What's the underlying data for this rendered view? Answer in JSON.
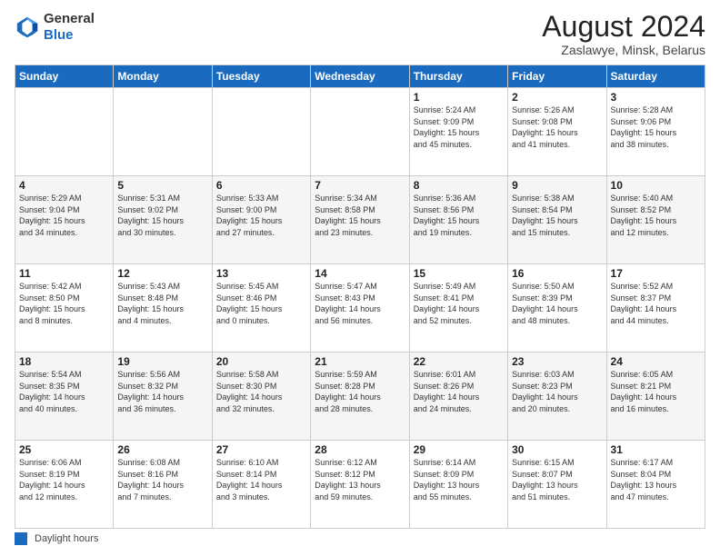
{
  "header": {
    "logo_line1": "General",
    "logo_line2": "Blue",
    "main_title": "August 2024",
    "subtitle": "Zaslawye, Minsk, Belarus"
  },
  "days_of_week": [
    "Sunday",
    "Monday",
    "Tuesday",
    "Wednesday",
    "Thursday",
    "Friday",
    "Saturday"
  ],
  "weeks": [
    [
      {
        "day": "",
        "info": ""
      },
      {
        "day": "",
        "info": ""
      },
      {
        "day": "",
        "info": ""
      },
      {
        "day": "",
        "info": ""
      },
      {
        "day": "1",
        "info": "Sunrise: 5:24 AM\nSunset: 9:09 PM\nDaylight: 15 hours\nand 45 minutes."
      },
      {
        "day": "2",
        "info": "Sunrise: 5:26 AM\nSunset: 9:08 PM\nDaylight: 15 hours\nand 41 minutes."
      },
      {
        "day": "3",
        "info": "Sunrise: 5:28 AM\nSunset: 9:06 PM\nDaylight: 15 hours\nand 38 minutes."
      }
    ],
    [
      {
        "day": "4",
        "info": "Sunrise: 5:29 AM\nSunset: 9:04 PM\nDaylight: 15 hours\nand 34 minutes."
      },
      {
        "day": "5",
        "info": "Sunrise: 5:31 AM\nSunset: 9:02 PM\nDaylight: 15 hours\nand 30 minutes."
      },
      {
        "day": "6",
        "info": "Sunrise: 5:33 AM\nSunset: 9:00 PM\nDaylight: 15 hours\nand 27 minutes."
      },
      {
        "day": "7",
        "info": "Sunrise: 5:34 AM\nSunset: 8:58 PM\nDaylight: 15 hours\nand 23 minutes."
      },
      {
        "day": "8",
        "info": "Sunrise: 5:36 AM\nSunset: 8:56 PM\nDaylight: 15 hours\nand 19 minutes."
      },
      {
        "day": "9",
        "info": "Sunrise: 5:38 AM\nSunset: 8:54 PM\nDaylight: 15 hours\nand 15 minutes."
      },
      {
        "day": "10",
        "info": "Sunrise: 5:40 AM\nSunset: 8:52 PM\nDaylight: 15 hours\nand 12 minutes."
      }
    ],
    [
      {
        "day": "11",
        "info": "Sunrise: 5:42 AM\nSunset: 8:50 PM\nDaylight: 15 hours\nand 8 minutes."
      },
      {
        "day": "12",
        "info": "Sunrise: 5:43 AM\nSunset: 8:48 PM\nDaylight: 15 hours\nand 4 minutes."
      },
      {
        "day": "13",
        "info": "Sunrise: 5:45 AM\nSunset: 8:46 PM\nDaylight: 15 hours\nand 0 minutes."
      },
      {
        "day": "14",
        "info": "Sunrise: 5:47 AM\nSunset: 8:43 PM\nDaylight: 14 hours\nand 56 minutes."
      },
      {
        "day": "15",
        "info": "Sunrise: 5:49 AM\nSunset: 8:41 PM\nDaylight: 14 hours\nand 52 minutes."
      },
      {
        "day": "16",
        "info": "Sunrise: 5:50 AM\nSunset: 8:39 PM\nDaylight: 14 hours\nand 48 minutes."
      },
      {
        "day": "17",
        "info": "Sunrise: 5:52 AM\nSunset: 8:37 PM\nDaylight: 14 hours\nand 44 minutes."
      }
    ],
    [
      {
        "day": "18",
        "info": "Sunrise: 5:54 AM\nSunset: 8:35 PM\nDaylight: 14 hours\nand 40 minutes."
      },
      {
        "day": "19",
        "info": "Sunrise: 5:56 AM\nSunset: 8:32 PM\nDaylight: 14 hours\nand 36 minutes."
      },
      {
        "day": "20",
        "info": "Sunrise: 5:58 AM\nSunset: 8:30 PM\nDaylight: 14 hours\nand 32 minutes."
      },
      {
        "day": "21",
        "info": "Sunrise: 5:59 AM\nSunset: 8:28 PM\nDaylight: 14 hours\nand 28 minutes."
      },
      {
        "day": "22",
        "info": "Sunrise: 6:01 AM\nSunset: 8:26 PM\nDaylight: 14 hours\nand 24 minutes."
      },
      {
        "day": "23",
        "info": "Sunrise: 6:03 AM\nSunset: 8:23 PM\nDaylight: 14 hours\nand 20 minutes."
      },
      {
        "day": "24",
        "info": "Sunrise: 6:05 AM\nSunset: 8:21 PM\nDaylight: 14 hours\nand 16 minutes."
      }
    ],
    [
      {
        "day": "25",
        "info": "Sunrise: 6:06 AM\nSunset: 8:19 PM\nDaylight: 14 hours\nand 12 minutes."
      },
      {
        "day": "26",
        "info": "Sunrise: 6:08 AM\nSunset: 8:16 PM\nDaylight: 14 hours\nand 7 minutes."
      },
      {
        "day": "27",
        "info": "Sunrise: 6:10 AM\nSunset: 8:14 PM\nDaylight: 14 hours\nand 3 minutes."
      },
      {
        "day": "28",
        "info": "Sunrise: 6:12 AM\nSunset: 8:12 PM\nDaylight: 13 hours\nand 59 minutes."
      },
      {
        "day": "29",
        "info": "Sunrise: 6:14 AM\nSunset: 8:09 PM\nDaylight: 13 hours\nand 55 minutes."
      },
      {
        "day": "30",
        "info": "Sunrise: 6:15 AM\nSunset: 8:07 PM\nDaylight: 13 hours\nand 51 minutes."
      },
      {
        "day": "31",
        "info": "Sunrise: 6:17 AM\nSunset: 8:04 PM\nDaylight: 13 hours\nand 47 minutes."
      }
    ]
  ],
  "footer": {
    "label": "Daylight hours"
  }
}
